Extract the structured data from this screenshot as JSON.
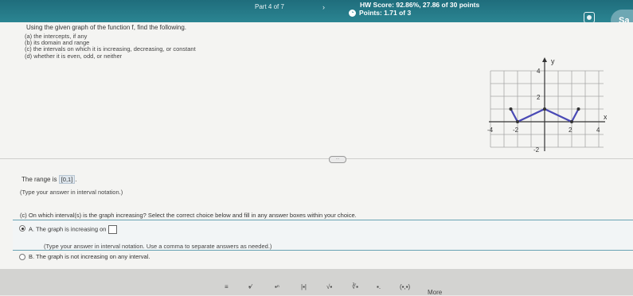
{
  "topbar": {
    "part": "Part 4 of 7",
    "hw_score": "HW Score: 92.86%, 27.86 of 30 points",
    "points": "Points: 1.71 of 3",
    "save": "Sa"
  },
  "question": {
    "prompt": "Using the given graph of the function f, find the following.",
    "parts": [
      "(a) the intercepts, if any",
      "(b) its domain and range",
      "(c) the intervals on which it is increasing, decreasing, or constant",
      "(d) whether it is even, odd, or neither"
    ]
  },
  "graph": {
    "y_label": "y",
    "x_label": "x",
    "tick_labels": {
      "y4": "4",
      "y2": "2",
      "yneg2": "-2",
      "xneg4": "-4",
      "xneg2": "-2",
      "x2": "2",
      "x4": "4"
    },
    "points": [
      [
        -2.5,
        1
      ],
      [
        -2,
        0
      ],
      [
        0,
        1
      ],
      [
        2,
        0
      ],
      [
        2.5,
        1
      ]
    ],
    "line_color": "#4a4ab5"
  },
  "answer": {
    "range_prefix": "The range is",
    "range_value": "[0,1]",
    "range_suffix": ".",
    "type_note": "(Type your answer in interval notation.)",
    "part_c": "(c) On which interval(s) is the graph increasing? Select the correct choice below and fill in any answer boxes within your choice.",
    "choice_a": "A.  The graph is increasing on",
    "choice_a_note": "(Type your answer in interval notation. Use a comma to separate answers as needed.)",
    "choice_b": "B.  The graph is not increasing on any interval."
  },
  "toolbar": {
    "items": [
      "≡",
      "▪⁄",
      "▪ⁿ",
      "|▪|",
      "√▪",
      "∛▪",
      "▪.",
      "(▪,▪)"
    ],
    "more": "More"
  }
}
